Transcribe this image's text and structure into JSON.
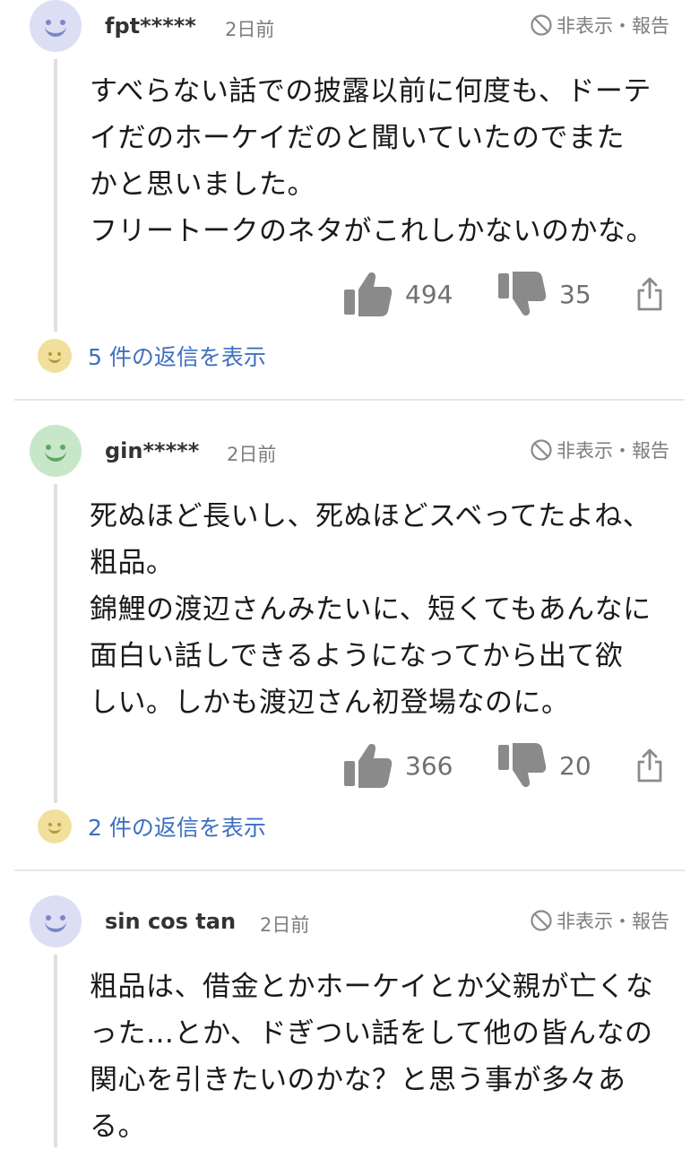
{
  "hide_report_label": "非表示・報告",
  "icons": {
    "like": "thumbs-up-icon",
    "dislike": "thumbs-down-icon",
    "share": "share-icon",
    "hide": "ban-icon"
  },
  "colors": {
    "link": "#3d6fc2",
    "icon_gray": "#8a8a8a",
    "avatar_blue": "#dcdff3",
    "avatar_green": "#c8e7c8",
    "reply_face": "#f2df9b"
  },
  "comments": [
    {
      "username": "fpt*****",
      "time": "2日前",
      "lines": [
        "すべらない話での披露以前に何度も、ドーテ",
        "イだのホーケイだのと聞いていたのでまた",
        "かと思いました。",
        "フリートークのネタがこれしかないのかな。"
      ],
      "likes": "494",
      "dislikes": "35",
      "replies_label": "5 件の返信を表示"
    },
    {
      "username": "gin*****",
      "time": "2日前",
      "lines": [
        "死ぬほど長いし、死ぬほどスベってたよね、",
        "粗品。",
        "錦鯉の渡辺さんみたいに、短くてもあんなに",
        "面白い話しできるようになってから出て欲",
        "しい。しかも渡辺さん初登場なのに。"
      ],
      "likes": "366",
      "dislikes": "20",
      "replies_label": "2 件の返信を表示"
    },
    {
      "username": "sin cos tan",
      "time": "2日前",
      "lines": [
        "粗品は、借金とかホーケイとか父親が亡くな",
        "った…とか、ドぎつい話をして他の皆んなの",
        "関心を引きたいのかな？と思う事が多々あ",
        "る。"
      ]
    }
  ]
}
